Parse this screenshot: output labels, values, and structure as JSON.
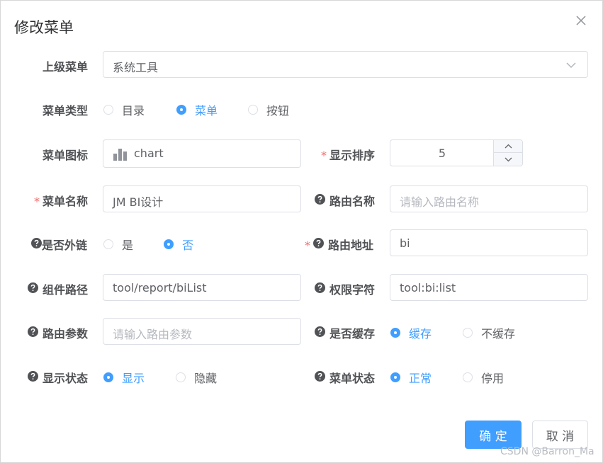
{
  "dialog": {
    "title": "修改菜单"
  },
  "form": {
    "parent_menu": {
      "label": "上级菜单",
      "value": "系统工具"
    },
    "menu_type": {
      "label": "菜单类型",
      "options": [
        "目录",
        "菜单",
        "按钮"
      ],
      "selected": "菜单"
    },
    "menu_icon": {
      "label": "菜单图标",
      "value": "chart",
      "icon": "bar-chart-icon"
    },
    "display_order": {
      "label": "显示排序",
      "value": "5"
    },
    "menu_name": {
      "label": "菜单名称",
      "value": "JM BI设计"
    },
    "route_name": {
      "label": "路由名称",
      "placeholder": "请输入路由名称"
    },
    "is_external": {
      "label": "是否外链",
      "options": [
        "是",
        "否"
      ],
      "selected": "否"
    },
    "route_path": {
      "label": "路由地址",
      "value": "bi"
    },
    "component_path": {
      "label": "组件路径",
      "value": "tool/report/biList"
    },
    "permission": {
      "label": "权限字符",
      "value": "tool:bi:list"
    },
    "route_params": {
      "label": "路由参数",
      "placeholder": "请输入路由参数"
    },
    "is_cache": {
      "label": "是否缓存",
      "options": [
        "缓存",
        "不缓存"
      ],
      "selected": "缓存"
    },
    "visible": {
      "label": "显示状态",
      "options": [
        "显示",
        "隐藏"
      ],
      "selected": "显示"
    },
    "status": {
      "label": "菜单状态",
      "options": [
        "正常",
        "停用"
      ],
      "selected": "正常"
    }
  },
  "footer": {
    "confirm": "确 定",
    "cancel": "取 消"
  },
  "required_mark": "*",
  "watermark": "CSDN @Barron_Ma",
  "colors": {
    "primary": "#409eff",
    "required": "#f56c6c",
    "border": "#dcdfe6"
  }
}
